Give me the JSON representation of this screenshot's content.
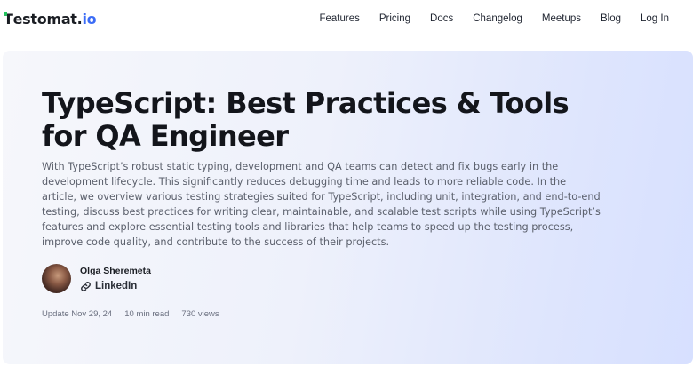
{
  "header": {
    "logo_main": "estomat.",
    "logo_first": "T",
    "logo_accent": "io",
    "nav": [
      "Features",
      "Pricing",
      "Docs",
      "Changelog",
      "Meetups",
      "Blog",
      "Log In"
    ]
  },
  "article": {
    "title": "TypeScript: Best Practices & Tools for QA Engineer",
    "intro": "With TypeScript’s robust static typing, development and QA teams can detect and fix bugs early in the development lifecycle. This significantly reduces debugging time and leads to more reliable code. In the article, we overview various testing strategies suited for TypeScript, including unit, integration, and end-to-end testing, discuss best practices for writing clear, maintainable, and scalable test scripts while using TypeScript’s features and explore essential testing tools and libraries that help teams to speed up the testing process, improve code quality, and contribute to the success of their projects.",
    "author": {
      "name": "Olga Sheremeta",
      "link_label": "LinkedIn",
      "link_icon": "link-icon"
    },
    "meta": {
      "updated": "Update Nov 29, 24",
      "read_time": "10 min read",
      "views": "730 views"
    }
  },
  "colors": {
    "accent": "#3b6cf6",
    "logo_tick": "#22c55e",
    "hero_gradient_end": "#d7e0ff"
  }
}
